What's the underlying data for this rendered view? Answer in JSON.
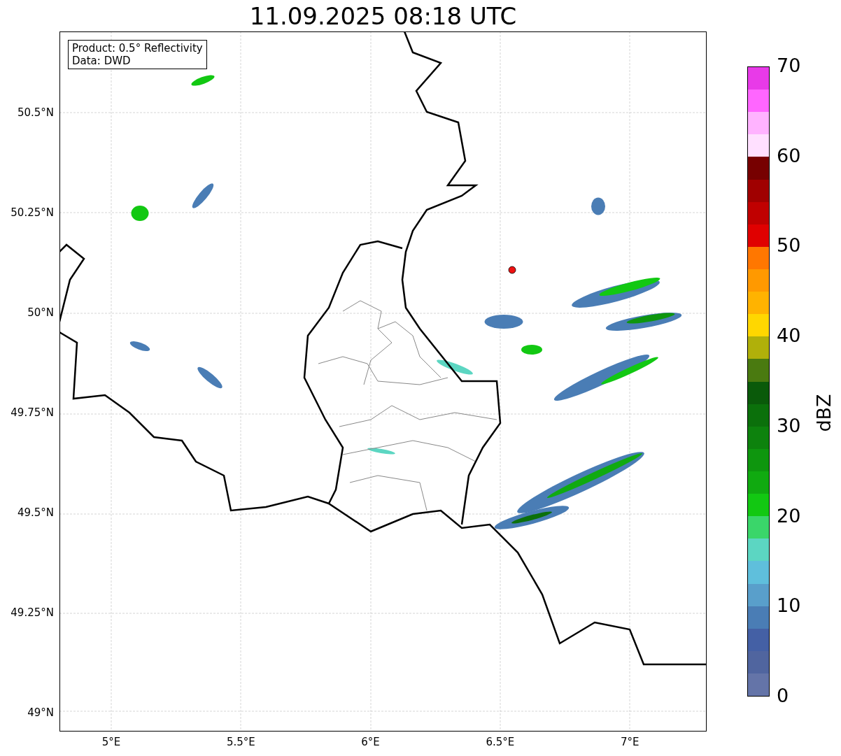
{
  "title": "11.09.2025 08:18 UTC",
  "info_box": [
    "Product: 0.5° Reflectivity",
    "Data: DWD"
  ],
  "map": {
    "x_ticks": [
      "5°E",
      "5.5°E",
      "6°E",
      "6.5°E",
      "7°E"
    ],
    "y_ticks": [
      "50.5°N",
      "50.25°N",
      "50°N",
      "49.75°N",
      "49.5°N",
      "49.25°N",
      "49°N"
    ]
  },
  "colorbar": {
    "label": "dBZ",
    "ticks": [
      "70",
      "60",
      "50",
      "40",
      "30",
      "20",
      "10",
      "0"
    ],
    "segments": [
      {
        "color": "#e83ae8"
      },
      {
        "color": "#ff66ff"
      },
      {
        "color": "#ffb3ff"
      },
      {
        "color": "#ffe0ff"
      },
      {
        "color": "#770000"
      },
      {
        "color": "#a00000"
      },
      {
        "color": "#c00000"
      },
      {
        "color": "#e00000"
      },
      {
        "color": "#ff7700"
      },
      {
        "color": "#ff9900"
      },
      {
        "color": "#ffb300"
      },
      {
        "color": "#ffd700"
      },
      {
        "color": "#b0b00a"
      },
      {
        "color": "#4a7a10"
      },
      {
        "color": "#0a5a0a"
      },
      {
        "color": "#0b700b"
      },
      {
        "color": "#0d820d"
      },
      {
        "color": "#0e960e"
      },
      {
        "color": "#10aa10"
      },
      {
        "color": "#12c812"
      },
      {
        "color": "#3ad66a"
      },
      {
        "color": "#5cd6c2"
      },
      {
        "color": "#5fbfdc"
      },
      {
        "color": "#599fcb"
      },
      {
        "color": "#4a7db5"
      },
      {
        "color": "#4460a5"
      },
      {
        "color": "#50659f"
      },
      {
        "color": "#6474a8"
      }
    ]
  }
}
